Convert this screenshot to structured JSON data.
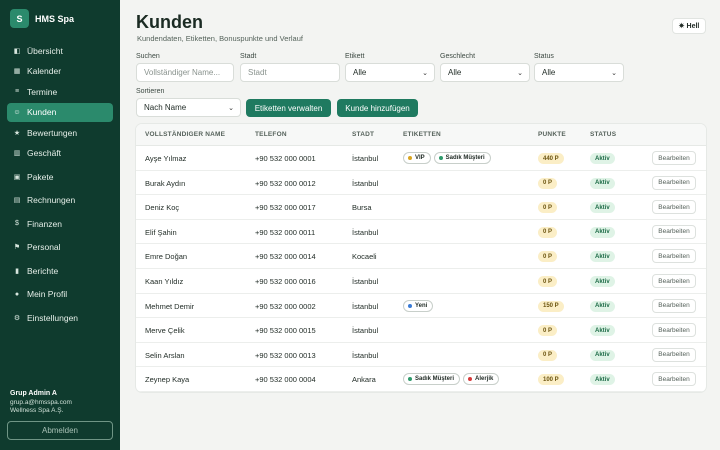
{
  "brand": {
    "logo_letter": "S",
    "name": "HMS Spa"
  },
  "sidebar": {
    "items": [
      {
        "label": "Übersicht",
        "icon": "overview-icon",
        "glyph": "◧",
        "active": false
      },
      {
        "label": "Kalender",
        "icon": "calendar-icon",
        "glyph": "▦",
        "active": false
      },
      {
        "label": "Termine",
        "icon": "appointments-icon",
        "glyph": "≡",
        "active": false
      },
      {
        "label": "Kunden",
        "icon": "customers-icon",
        "glyph": "☺",
        "active": true
      },
      {
        "label": "Bewertungen",
        "icon": "star-icon",
        "glyph": "★",
        "active": false
      },
      {
        "label": "Geschäft",
        "icon": "shop-icon",
        "glyph": "▥",
        "active": false
      },
      {
        "label": "Pakete",
        "icon": "package-icon",
        "glyph": "▣",
        "active": false
      },
      {
        "label": "Rechnungen",
        "icon": "invoice-icon",
        "glyph": "▤",
        "active": false
      },
      {
        "label": "Finanzen",
        "icon": "money-icon",
        "glyph": "$",
        "active": false
      },
      {
        "label": "Personal",
        "icon": "staff-icon",
        "glyph": "⚑",
        "active": false
      },
      {
        "label": "Berichte",
        "icon": "reports-icon",
        "glyph": "▮",
        "active": false
      },
      {
        "label": "Mein Profil",
        "icon": "profile-icon",
        "glyph": "●",
        "active": false
      },
      {
        "label": "Einstellungen",
        "icon": "gear-icon",
        "glyph": "⚙",
        "active": false
      }
    ],
    "user": {
      "name": "Grup Admin A",
      "email": "grup.a@hmsspa.com",
      "company": "Wellness Spa A.Ş."
    },
    "logout_label": "Abmelden"
  },
  "header": {
    "title": "Kunden",
    "subtitle": "Kundendaten, Etiketten, Bonuspunkte und Verlauf",
    "theme_label": "Hell"
  },
  "filters": {
    "search": {
      "label": "Suchen",
      "placeholder": "Vollständiger Name..."
    },
    "city": {
      "label": "Stadt",
      "placeholder": "Stadt"
    },
    "tag": {
      "label": "Etikett",
      "value": "Alle"
    },
    "gender": {
      "label": "Geschlecht",
      "value": "Alle"
    },
    "status": {
      "label": "Status",
      "value": "Alle"
    },
    "sort": {
      "label": "Sortieren",
      "value": "Nach Name"
    },
    "manage_tags_label": "Etiketten verwalten",
    "add_customer_label": "Kunde hinzufügen"
  },
  "table": {
    "headers": [
      "VOLLSTÄNDIGER NAME",
      "TELEFON",
      "STADT",
      "ETIKETTEN",
      "PUNKTE",
      "STATUS"
    ],
    "edit_label": "Bearbeiten",
    "rows": [
      {
        "name": "Ayşe Yılmaz",
        "phone": "+90 532 000 0001",
        "city": "İstanbul",
        "tags": [
          {
            "label": "VIP",
            "color": "#d9a520"
          },
          {
            "label": "Sadık Müşteri",
            "color": "#2e9a6b"
          }
        ],
        "points": "440 P",
        "status": "Aktiv"
      },
      {
        "name": "Burak Aydın",
        "phone": "+90 532 000 0012",
        "city": "İstanbul",
        "tags": [],
        "points": "0 P",
        "status": "Aktiv"
      },
      {
        "name": "Deniz Koç",
        "phone": "+90 532 000 0017",
        "city": "Bursa",
        "tags": [],
        "points": "0 P",
        "status": "Aktiv"
      },
      {
        "name": "Elif Şahin",
        "phone": "+90 532 000 0011",
        "city": "İstanbul",
        "tags": [],
        "points": "0 P",
        "status": "Aktiv"
      },
      {
        "name": "Emre Doğan",
        "phone": "+90 532 000 0014",
        "city": "Kocaeli",
        "tags": [],
        "points": "0 P",
        "status": "Aktiv"
      },
      {
        "name": "Kaan Yıldız",
        "phone": "+90 532 000 0016",
        "city": "İstanbul",
        "tags": [],
        "points": "0 P",
        "status": "Aktiv"
      },
      {
        "name": "Mehmet Demir",
        "phone": "+90 532 000 0002",
        "city": "İstanbul",
        "tags": [
          {
            "label": "Yeni",
            "color": "#3a7bd5"
          }
        ],
        "points": "150 P",
        "status": "Aktiv"
      },
      {
        "name": "Merve Çelik",
        "phone": "+90 532 000 0015",
        "city": "İstanbul",
        "tags": [],
        "points": "0 P",
        "status": "Aktiv"
      },
      {
        "name": "Selin Arslan",
        "phone": "+90 532 000 0013",
        "city": "İstanbul",
        "tags": [],
        "points": "0 P",
        "status": "Aktiv"
      },
      {
        "name": "Zeynep Kaya",
        "phone": "+90 532 000 0004",
        "city": "Ankara",
        "tags": [
          {
            "label": "Sadık Müşteri",
            "color": "#2e9a6b"
          },
          {
            "label": "Alerjik",
            "color": "#d63a3a"
          }
        ],
        "points": "100 P",
        "status": "Aktiv"
      }
    ]
  }
}
